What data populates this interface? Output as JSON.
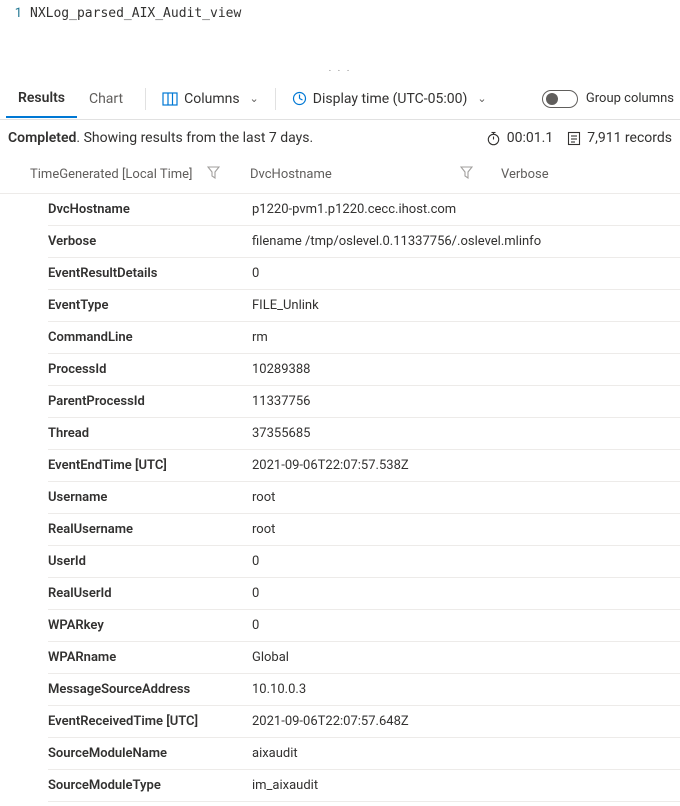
{
  "editor": {
    "line_number": "1",
    "code": "NXLog_parsed_AIX_Audit_view"
  },
  "drag_dots": "· · ·",
  "tabs": {
    "results": "Results",
    "chart": "Chart"
  },
  "toolbar": {
    "columns": "Columns",
    "display_time": "Display time (UTC-05:00)",
    "group_columns": "Group columns"
  },
  "status": {
    "completed": "Completed",
    "text": ". Showing results from the last 7 days.",
    "elapsed": "00:01.1",
    "records": "7,911 records"
  },
  "headers": {
    "time_generated": "TimeGenerated [Local Time]",
    "dvc_hostname": "DvcHostname",
    "verbose": "Verbose"
  },
  "details": [
    {
      "k": "DvcHostname",
      "v": "p1220-pvm1.p1220.cecc.ihost.com"
    },
    {
      "k": "Verbose",
      "v": "filename /tmp/oslevel.0.11337756/.oslevel.mlinfo"
    },
    {
      "k": "EventResultDetails",
      "v": "0"
    },
    {
      "k": "EventType",
      "v": "FILE_Unlink"
    },
    {
      "k": "CommandLine",
      "v": "rm"
    },
    {
      "k": "ProcessId",
      "v": "10289388"
    },
    {
      "k": "ParentProcessId",
      "v": "11337756"
    },
    {
      "k": "Thread",
      "v": "37355685"
    },
    {
      "k": "EventEndTime [UTC]",
      "v": "2021-09-06T22:07:57.538Z"
    },
    {
      "k": "Username",
      "v": "root"
    },
    {
      "k": "RealUsername",
      "v": "root"
    },
    {
      "k": "UserId",
      "v": "0"
    },
    {
      "k": "RealUserId",
      "v": "0"
    },
    {
      "k": "WPARkey",
      "v": "0"
    },
    {
      "k": "WPARname",
      "v": "Global"
    },
    {
      "k": "MessageSourceAddress",
      "v": "10.10.0.3"
    },
    {
      "k": "EventReceivedTime [UTC]",
      "v": "2021-09-06T22:07:57.648Z"
    },
    {
      "k": "SourceModuleName",
      "v": "aixaudit"
    },
    {
      "k": "SourceModuleType",
      "v": "im_aixaudit"
    }
  ]
}
